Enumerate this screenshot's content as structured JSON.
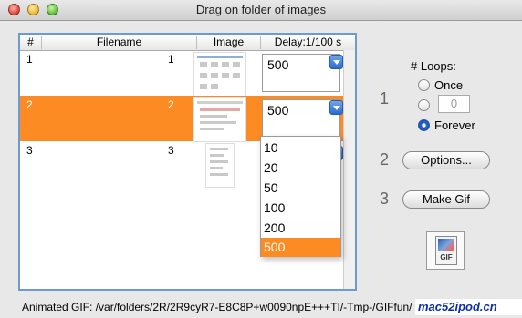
{
  "window": {
    "title": "Drag on folder of images"
  },
  "table": {
    "columns": [
      "#",
      "Filename",
      "Image",
      "Delay:1/100 s"
    ],
    "rows": [
      {
        "index": "1",
        "filename": "1",
        "delay": "500",
        "selected": false
      },
      {
        "index": "2",
        "filename": "2",
        "delay": "500",
        "selected": true
      },
      {
        "index": "3",
        "filename": "3",
        "delay": "",
        "selected": false
      }
    ]
  },
  "dropdown": {
    "options": [
      "10",
      "20",
      "50",
      "100",
      "200",
      "500"
    ],
    "selected": "500"
  },
  "loops": {
    "label": "# Loops:",
    "step": "1",
    "once_label": "Once",
    "count_value": "0",
    "forever_label": "Forever",
    "selected": "Forever"
  },
  "options": {
    "step": "2",
    "button_label": "Options..."
  },
  "make_gif": {
    "step": "3",
    "button_label": "Make Gif"
  },
  "gif_icon": {
    "label": "GIF"
  },
  "status": {
    "text": "Animated GIF: /var/folders/2R/2R9cyR7-E8C8P+w0090npE+++TI/-Tmp-/GIFfun/"
  },
  "watermark": {
    "text": "mac52ipod.cn"
  },
  "colors": {
    "selection": "#fb8b22",
    "accent": "#2a6bd2",
    "frame": "#6d9ad3"
  }
}
